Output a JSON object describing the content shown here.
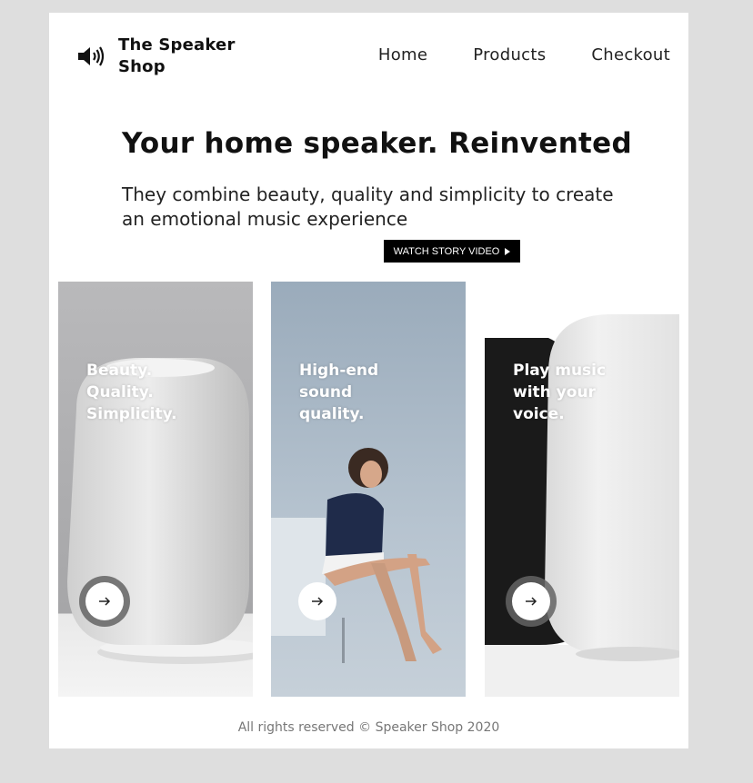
{
  "header": {
    "logo_icon": "speaker-volume-icon",
    "brand": "The Speaker Shop",
    "nav": [
      "Home",
      "Products",
      "Checkout"
    ]
  },
  "hero": {
    "title": "Your home speaker. Reinvented",
    "subtitle": "They combine beauty, quality and simplicity to create an emotional music experience",
    "cta_label": "WATCH STORY VIDEO",
    "cta_icon": "play-icon"
  },
  "cards": [
    {
      "text": "Beauty. Quality. Simplicity.",
      "image": "white-speaker-photo",
      "button_icon": "arrow-right-icon"
    },
    {
      "text": "High-end sound quality.",
      "image": "woman-sitting-photo",
      "button_icon": "arrow-right-icon"
    },
    {
      "text": "Play music with your voice.",
      "image": "two-speakers-photo",
      "button_icon": "arrow-right-icon"
    }
  ],
  "footer": {
    "text": "All rights reserved © Speaker Shop 2020"
  }
}
